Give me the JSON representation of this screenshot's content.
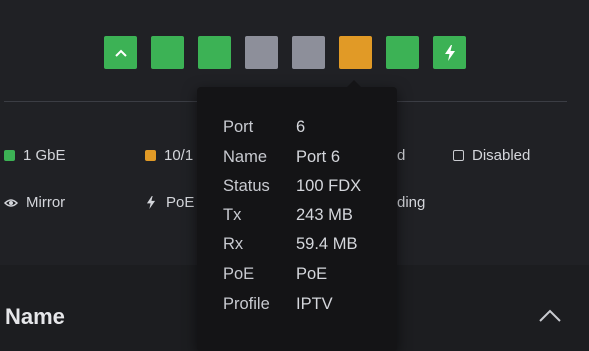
{
  "colors": {
    "background": "#202125",
    "gbe": "#3cb255",
    "mbe": "#e19a26",
    "inactive": "#8d8f9a",
    "tooltip_bg": "#141416"
  },
  "ports": [
    {
      "number": 1,
      "state": "1 GbE",
      "color": "#3cb255",
      "icon": "chevron-up-icon"
    },
    {
      "number": 2,
      "state": "1 GbE",
      "color": "#3cb255",
      "icon": ""
    },
    {
      "number": 3,
      "state": "1 GbE",
      "color": "#3cb255",
      "icon": ""
    },
    {
      "number": 4,
      "state": "inactive",
      "color": "#8d8f9a",
      "icon": ""
    },
    {
      "number": 5,
      "state": "inactive",
      "color": "#8d8f9a",
      "icon": ""
    },
    {
      "number": 6,
      "state": "10/100",
      "color": "#e19a26",
      "icon": ""
    },
    {
      "number": 7,
      "state": "1 GbE",
      "color": "#3cb255",
      "icon": ""
    },
    {
      "number": 8,
      "state": "1 GbE",
      "color": "#3cb255",
      "icon": "lightning-icon"
    }
  ],
  "legend": {
    "gbe": "1 GbE",
    "mbe": "10/1",
    "partial_d": "d",
    "disabled": "Disabled",
    "mirror": "Mirror",
    "poe": "PoE",
    "partial_ding": "ding"
  },
  "tooltip": {
    "rows": [
      {
        "label": "Port",
        "value": "6"
      },
      {
        "label": "Name",
        "value": "Port 6"
      },
      {
        "label": "Status",
        "value": "100 FDX"
      },
      {
        "label": "Tx",
        "value": "243 MB"
      },
      {
        "label": "Rx",
        "value": "59.4 MB"
      },
      {
        "label": "PoE",
        "value": "PoE"
      },
      {
        "label": "Profile",
        "value": "IPTV"
      }
    ]
  },
  "section": {
    "title": "Name"
  }
}
